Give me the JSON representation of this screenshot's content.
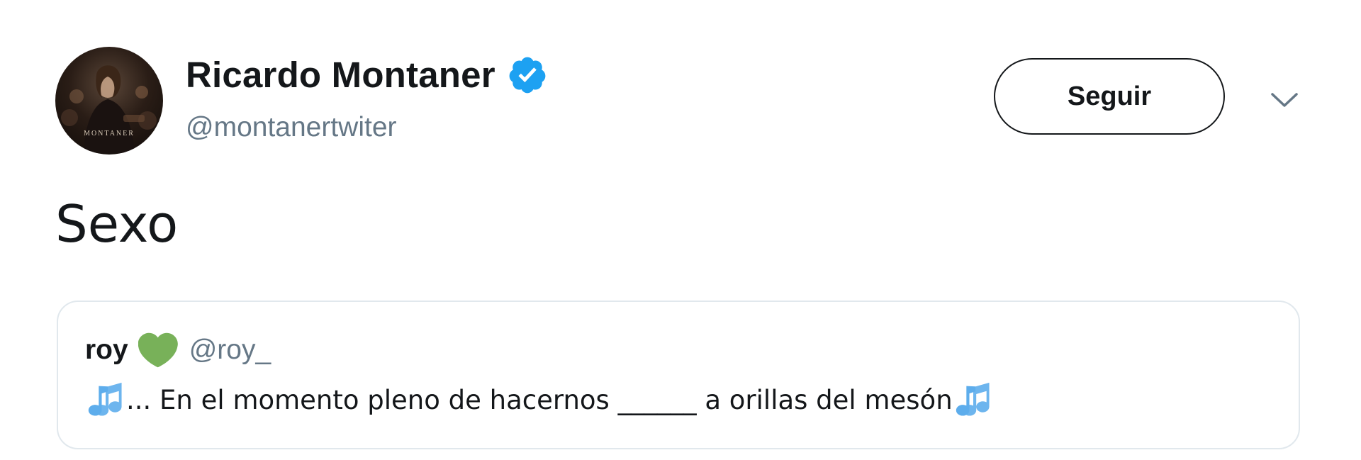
{
  "author": {
    "display_name": "Ricardo Montaner",
    "handle": "@montanertwiter",
    "verified": true,
    "avatar_caption": "MONTANER",
    "verified_icon": "verified-badge-icon"
  },
  "actions": {
    "follow_label": "Seguir",
    "more_icon": "chevron-down-icon"
  },
  "tweet": {
    "text": "Sexo"
  },
  "quoted_tweet": {
    "name": "roy",
    "name_emoji_icon": "green-heart-icon",
    "handle": "@roy_",
    "lead_icon": "music-notes-icon",
    "text": "... En el momento pleno de hacernos ______ a orillas del mesón",
    "trail_icon": "music-notes-icon"
  },
  "colors": {
    "text_primary": "#14171a",
    "text_secondary": "#657786",
    "verified_blue": "#1da1f2",
    "heart_green": "#78b159",
    "notes_blue": "#5dadec",
    "border": "#e1e8ed"
  }
}
